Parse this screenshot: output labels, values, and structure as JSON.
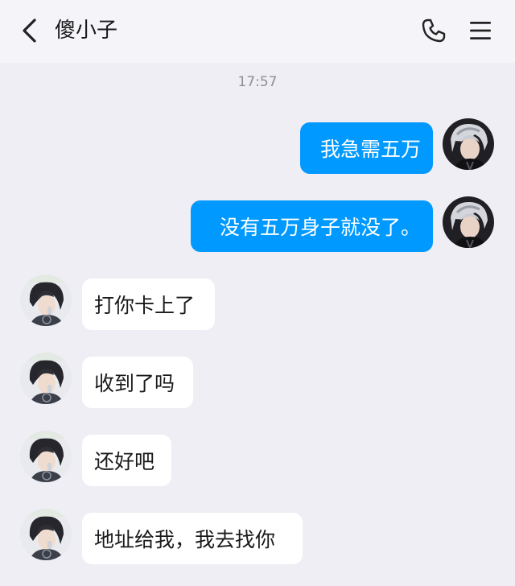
{
  "header": {
    "title": "傻小子",
    "back_icon": "chevron-left-icon",
    "call_icon": "phone-icon",
    "menu_icon": "hamburger-menu-icon"
  },
  "timestamp": "17:57",
  "messages": [
    {
      "direction": "outgoing",
      "text": "我急需五万"
    },
    {
      "direction": "outgoing",
      "text": "没有五万身子就没了。"
    },
    {
      "direction": "incoming",
      "text": "打你卡上了"
    },
    {
      "direction": "incoming",
      "text": "收到了吗"
    },
    {
      "direction": "incoming",
      "text": "还好吧"
    },
    {
      "direction": "incoming",
      "text": "地址给我，我去找你"
    }
  ],
  "colors": {
    "outgoing_bubble": "#0099ff",
    "incoming_bubble": "#ffffff",
    "background": "#eeeef4",
    "header_background": "#f5f5f9"
  }
}
